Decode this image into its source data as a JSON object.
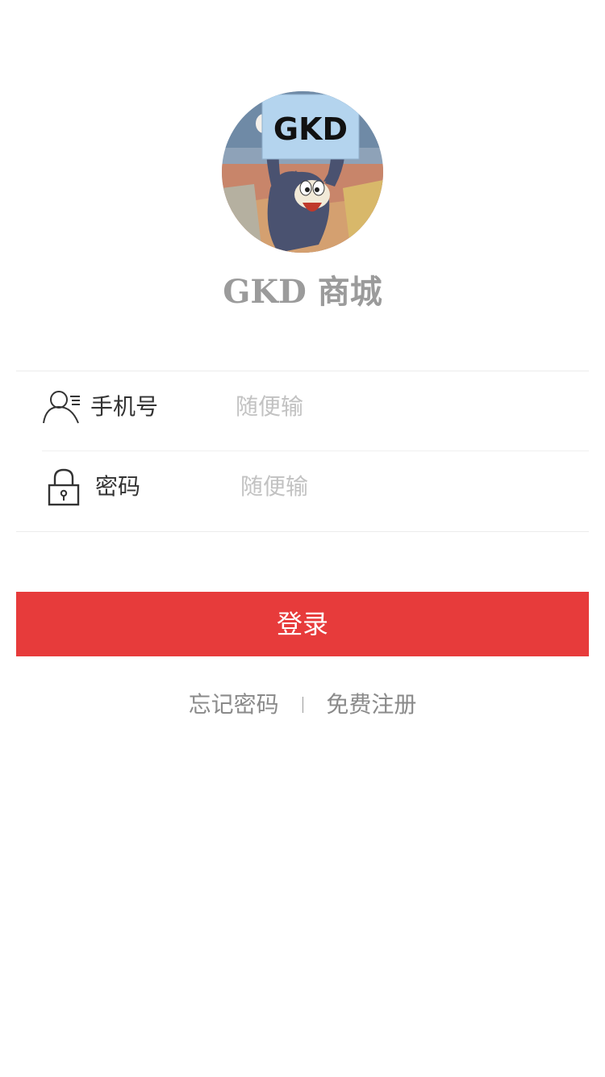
{
  "avatar": {
    "sign_text": "GKD"
  },
  "title": "GKD 商城",
  "form": {
    "phone": {
      "label": "手机号",
      "placeholder": "随便输",
      "icon": "user-icon"
    },
    "password": {
      "label": "密码",
      "placeholder": "随便输",
      "icon": "lock-icon"
    }
  },
  "login_button": "登录",
  "links": {
    "forgot": "忘记密码",
    "register": "免费注册"
  },
  "colors": {
    "primary": "#e73b3b",
    "title": "#9b9b9b",
    "placeholder": "#c2c2c2",
    "link": "#8a8a8a"
  }
}
